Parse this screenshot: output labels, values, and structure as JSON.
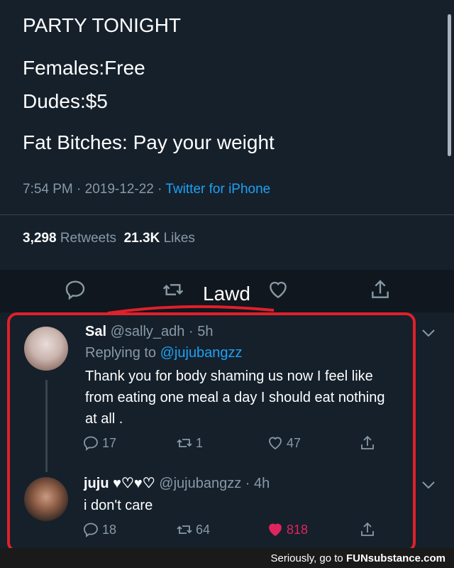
{
  "tweet": {
    "lines": [
      "PARTY TONIGHT",
      "Females:Free",
      "Dudes:$5",
      "Fat Bitches: Pay your weight"
    ],
    "time": "7:54 PM",
    "date": "2019-12-22",
    "source": "Twitter for iPhone",
    "retweets_count": "3,298",
    "retweets_label": "Retweets",
    "likes_count": "21.3K",
    "likes_label": "Likes"
  },
  "caption": "Lawd",
  "replies": [
    {
      "name": "Sal",
      "handle": "@sally_adh",
      "age": "5h",
      "replying_prefix": "Replying to",
      "replying_to": "@jujubangzz",
      "text_lines": [
        "Thank you for body shaming us now I feel like",
        "from eating one meal a day I should eat nothing",
        "at all ."
      ],
      "reply_count": "17",
      "retweet_count": "1",
      "like_count": "47"
    },
    {
      "name": "juju",
      "hearts": "♥♡♥♡",
      "handle": "@jujubangzz",
      "age": "4h",
      "text": "i don't care",
      "reply_count": "18",
      "retweet_count": "64",
      "like_count": "818"
    }
  ],
  "footer": {
    "prefix": "Seriously, go to",
    "brand": "FUNsubstance.com"
  },
  "colors": {
    "background": "#15202b",
    "link": "#1da1f2",
    "muted": "#8899a6",
    "liked": "#e0245e",
    "highlight": "#e0202a"
  }
}
